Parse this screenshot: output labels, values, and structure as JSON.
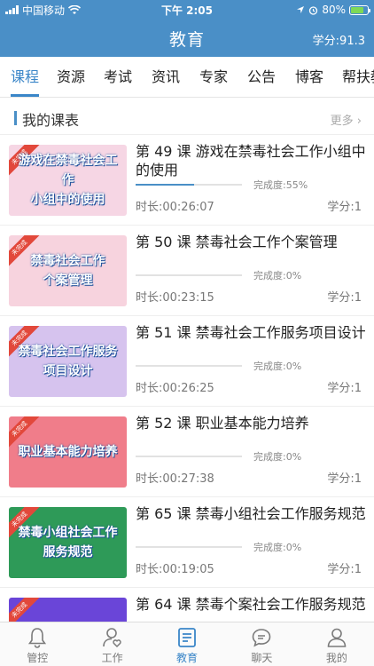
{
  "status_bar": {
    "carrier": "中国移动",
    "time": "下午 2:05",
    "battery": "80%"
  },
  "header": {
    "title": "教育",
    "score": "学分:91.3"
  },
  "tabs": [
    "课程",
    "资源",
    "考试",
    "资讯",
    "专家",
    "公告",
    "博客",
    "帮扶教"
  ],
  "active_tab_index": 0,
  "section": {
    "title": "我的课表",
    "more": "更多"
  },
  "courses": [
    {
      "title": "第 49 课  游戏在禁毒社会工作小组中的使用",
      "thumb_lines": [
        "游戏在禁毒社会工作",
        "小组中的使用"
      ],
      "thumb_badge": "未完成",
      "progress": 0.55,
      "progress_label": "完成度:55%",
      "duration": "时长:00:26:07",
      "credit": "学分:1"
    },
    {
      "title": "第 50 课  禁毒社会工作个案管理",
      "thumb_lines": [
        "禁毒社会工作",
        "个案管理"
      ],
      "thumb_badge": "未完成",
      "progress": 0,
      "progress_label": "完成度:0%",
      "duration": "时长:00:23:15",
      "credit": "学分:1"
    },
    {
      "title": "第 51 课  禁毒社会工作服务项目设计",
      "thumb_lines": [
        "禁毒社会工作服务",
        "项目设计"
      ],
      "thumb_badge": "未完成",
      "progress": 0,
      "progress_label": "完成度:0%",
      "duration": "时长:00:26:25",
      "credit": "学分:1"
    },
    {
      "title": "第 52 课  职业基本能力培养",
      "thumb_lines": [
        "职业基本能力培养"
      ],
      "thumb_badge": "未完成",
      "progress": 0,
      "progress_label": "完成度:0%",
      "duration": "时长:00:27:38",
      "credit": "学分:1"
    },
    {
      "title": "第 65 课  禁毒小组社会工作服务规范",
      "thumb_lines": [
        "禁毒小组社会工作",
        "服务规范"
      ],
      "thumb_badge": "未完成",
      "progress": 0,
      "progress_label": "完成度:0%",
      "duration": "时长:00:19:05",
      "credit": "学分:1"
    },
    {
      "title": "第 64 课  禁毒个案社会工作服务规范",
      "thumb_lines": [
        "",
        ""
      ],
      "thumb_badge": "未完成",
      "progress": 0,
      "progress_label": "",
      "duration": "",
      "credit": ""
    }
  ],
  "thumb_colors": [
    "#f6d6e4",
    "#f7d3de",
    "#d6c3ee",
    "#f07d8a",
    "#2e9a58",
    "#6a45d8"
  ],
  "bottom_tabs": [
    {
      "label": "管控",
      "icon": "bell-icon"
    },
    {
      "label": "工作",
      "icon": "person-heart-icon"
    },
    {
      "label": "教育",
      "icon": "book-list-icon"
    },
    {
      "label": "聊天",
      "icon": "chat-bubble-icon"
    },
    {
      "label": "我的",
      "icon": "user-icon"
    }
  ],
  "active_bottom_tab_index": 2,
  "colors": {
    "header_blue": "#4a8fc7",
    "accent": "#3a86c8"
  }
}
